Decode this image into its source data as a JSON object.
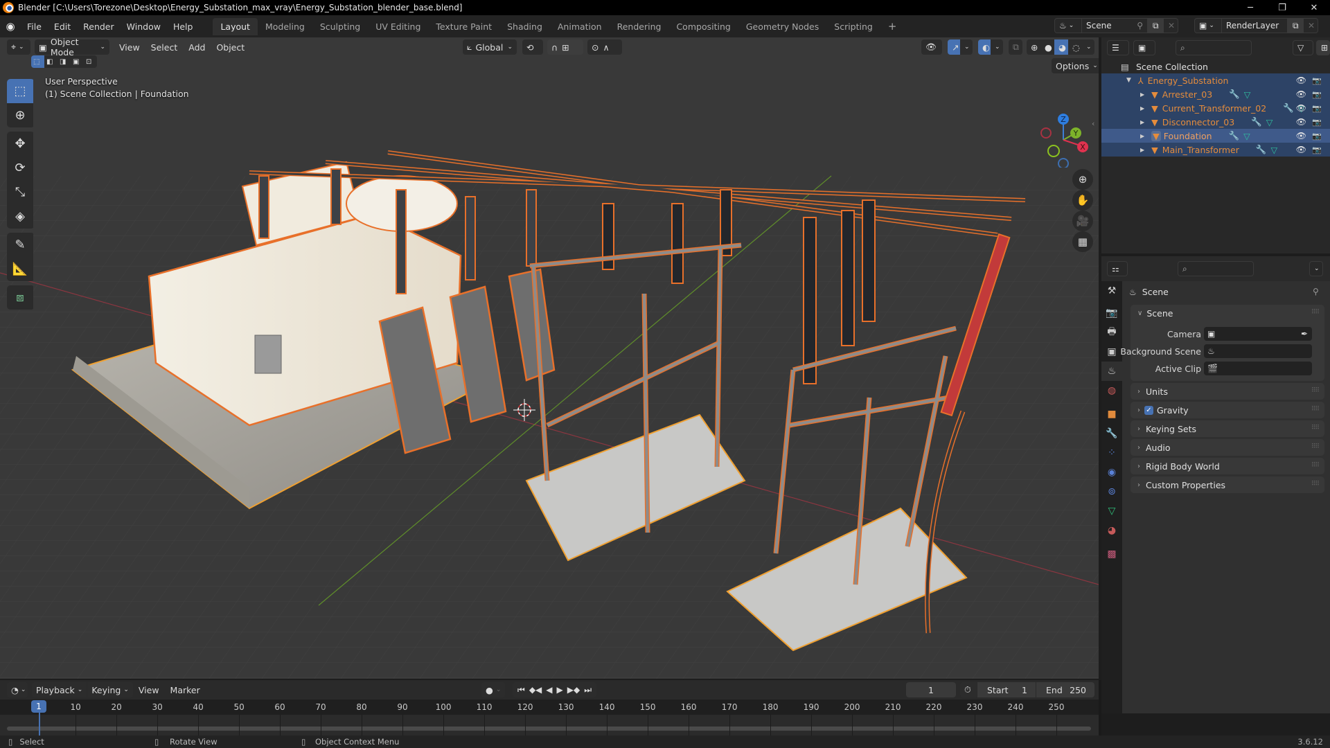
{
  "window": {
    "title": "Blender [C:\\Users\\Torezone\\Desktop\\Energy_Substation_max_vray\\Energy_Substation_blender_base.blend]",
    "controls": {
      "minimize": "─",
      "maximize": "❐",
      "close": "✕"
    }
  },
  "menu": [
    "File",
    "Edit",
    "Render",
    "Window",
    "Help"
  ],
  "workspaces": [
    {
      "label": "Layout",
      "active": true
    },
    {
      "label": "Modeling"
    },
    {
      "label": "Sculpting"
    },
    {
      "label": "UV Editing"
    },
    {
      "label": "Texture Paint"
    },
    {
      "label": "Shading"
    },
    {
      "label": "Animation"
    },
    {
      "label": "Rendering"
    },
    {
      "label": "Compositing"
    },
    {
      "label": "Geometry Nodes"
    },
    {
      "label": "Scripting"
    }
  ],
  "add_workspace": "+",
  "scene_selector": {
    "value": "Scene"
  },
  "view_layer_selector": {
    "value": "RenderLayer"
  },
  "viewport": {
    "mode": "Object Mode",
    "menus": [
      "View",
      "Select",
      "Add",
      "Object"
    ],
    "transform_orientation": "Global",
    "options_label": "Options",
    "overlay_line1": "User Perspective",
    "overlay_line2": "(1) Scene Collection | Foundation",
    "tools": [
      "select-box",
      "cursor",
      "move",
      "rotate",
      "scale",
      "transform",
      "annotate",
      "measure",
      "add-cube"
    ],
    "gizmo_axes": {
      "x": "X",
      "y": "Y",
      "z": "Z"
    },
    "colors": {
      "selection_outline": "#e8702a",
      "active_outline": "#f5a623",
      "grid_x": "#9b3a45",
      "grid_y": "#6c9b2e"
    }
  },
  "outliner": {
    "root": "Scene Collection",
    "collection": "Energy_Substation",
    "objects": [
      {
        "name": "Arrester_03",
        "selected": true
      },
      {
        "name": "Current_Transformer_02",
        "selected": true
      },
      {
        "name": "Disconnector_03",
        "selected": true
      },
      {
        "name": "Foundation",
        "selected": true,
        "active": true
      },
      {
        "name": "Main_Transformer",
        "selected": true
      }
    ]
  },
  "properties": {
    "context_title": "Scene",
    "scene_panel": {
      "title": "Scene",
      "camera_label": "Camera",
      "background_scene_label": "Background Scene",
      "active_clip_label": "Active Clip",
      "camera_value": "",
      "background_scene_value": "",
      "active_clip_value": ""
    },
    "panels": [
      {
        "title": "Units"
      },
      {
        "title": "Gravity",
        "checkbox": true
      },
      {
        "title": "Keying Sets"
      },
      {
        "title": "Audio"
      },
      {
        "title": "Rigid Body World"
      },
      {
        "title": "Custom Properties"
      }
    ]
  },
  "timeline": {
    "menus": {
      "playback": "Playback",
      "keying": "Keying",
      "view": "View",
      "marker": "Marker"
    },
    "current_frame": "1",
    "start_label": "Start",
    "start": "1",
    "end_label": "End",
    "end": "250",
    "ticks": [
      "10",
      "20",
      "30",
      "40",
      "50",
      "60",
      "70",
      "80",
      "90",
      "100",
      "110",
      "120",
      "130",
      "140",
      "150",
      "160",
      "170",
      "180",
      "190",
      "200",
      "210",
      "220",
      "230",
      "240",
      "250"
    ],
    "playhead": "1"
  },
  "statusbar": {
    "select": "Select",
    "rotate": "Rotate View",
    "context_menu": "Object Context Menu",
    "version": "3.6.12"
  }
}
